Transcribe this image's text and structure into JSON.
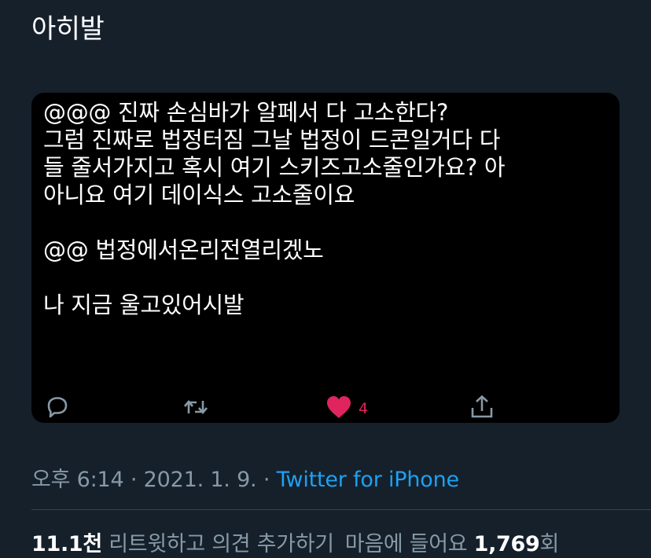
{
  "tweet": {
    "text": "아히발"
  },
  "quoted": {
    "lines": [
      "@@@ 진짜 손심바가 알페서 다 고소한다?",
      "그럼 진짜로 법정터짐 그날 법정이 드콘일거다 다",
      "들 줄서가지고 혹시 여기 스키즈고소줄인가요? 아",
      "아니요 여기 데이식스 고소줄이요",
      "",
      "@@ 법정에서온리전열리겠노",
      "",
      "나 지금 울고있어시발"
    ],
    "like_count": "4",
    "icons": {
      "reply": "reply-icon",
      "retweet": "retweet-icon",
      "like": "heart-icon",
      "share": "share-icon"
    },
    "like_color": "#e0245e"
  },
  "meta": {
    "time": "오후 6:14",
    "sep1": " · ",
    "date": "2021. 1. 9.",
    "sep2": " · ",
    "source": "Twitter for iPhone"
  },
  "stats": {
    "retweets_count": "11.1천",
    "retweets_label": "리트윗하고 의견 추가하기",
    "likes_label": "마음에 들어요",
    "likes_count": "1,769",
    "likes_suffix": "회"
  },
  "colors": {
    "background": "#15202b",
    "card": "#000000",
    "muted": "#8899a6",
    "link": "#1da1f2"
  }
}
